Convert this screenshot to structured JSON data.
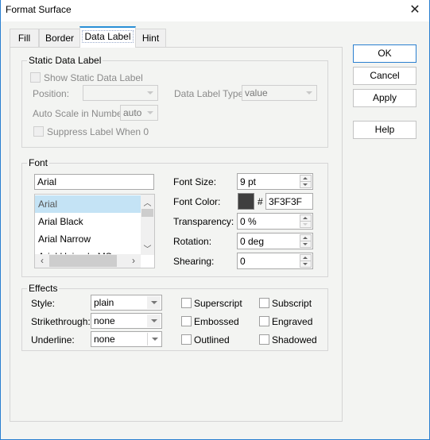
{
  "window": {
    "title": "Format Surface",
    "close_icon": "close-icon"
  },
  "tabs": [
    {
      "label": "Fill",
      "active": false
    },
    {
      "label": "Border",
      "active": false
    },
    {
      "label": "Data Label",
      "active": true
    },
    {
      "label": "Hint",
      "active": false
    }
  ],
  "static_data_label": {
    "group_label": "Static Data Label",
    "show_label": "Show Static Data Label",
    "show_checked": false,
    "position_label": "Position:",
    "position_value": "",
    "type_label": "Data Label Type:",
    "type_value": "value",
    "auto_scale_label": "Auto Scale in Number:",
    "auto_scale_value": "auto",
    "suppress_label": "Suppress Label When 0",
    "suppress_checked": false
  },
  "font": {
    "group_label": "Font",
    "name_value": "Arial",
    "list": [
      "Arial",
      "Arial Black",
      "Arial Narrow",
      "Arial Unicode MS"
    ],
    "selected_index": 0,
    "size_label": "Font Size:",
    "size_value": "9 pt",
    "color_label": "Font Color:",
    "color_hash": "#",
    "color_value": "3F3F3F",
    "color_swatch": "#3f3f3f",
    "transparency_label": "Transparency:",
    "transparency_value": "0 %",
    "rotation_label": "Rotation:",
    "rotation_value": "0 deg",
    "shearing_label": "Shearing:",
    "shearing_value": "0"
  },
  "effects": {
    "group_label": "Effects",
    "style_label": "Style:",
    "style_value": "plain",
    "strikethrough_label": "Strikethrough:",
    "strikethrough_value": "none",
    "underline_label": "Underline:",
    "underline_value": "none",
    "checkboxes": [
      {
        "label": "Superscript",
        "checked": false
      },
      {
        "label": "Subscript",
        "checked": false
      },
      {
        "label": "Embossed",
        "checked": false
      },
      {
        "label": "Engraved",
        "checked": false
      },
      {
        "label": "Outlined",
        "checked": false
      },
      {
        "label": "Shadowed",
        "checked": false
      }
    ]
  },
  "buttons": {
    "ok": "OK",
    "cancel": "Cancel",
    "apply": "Apply",
    "help": "Help"
  }
}
